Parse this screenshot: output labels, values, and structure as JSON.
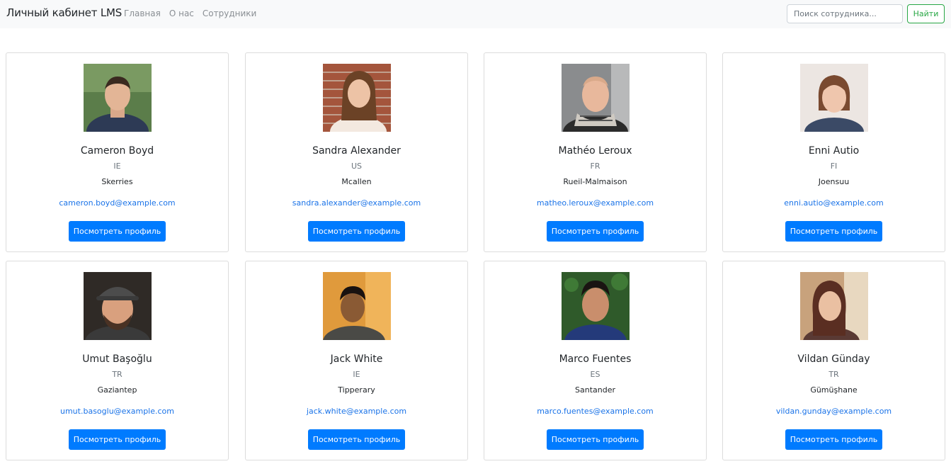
{
  "navbar": {
    "brand": "Личный кабинет LMS",
    "links": [
      "Главная",
      "О нас",
      "Сотрудники"
    ],
    "search_placeholder": "Поиск сотрудника...",
    "search_button": "Найти"
  },
  "colors": {
    "primary": "#007bff",
    "success": "#28a745",
    "link": "#1a73e8",
    "navbar_bg": "#f8f9fa"
  },
  "employees": [
    {
      "name": "Cameron Boyd",
      "country": "IE",
      "city": "Skerries",
      "email": "cameron.boyd@example.com",
      "button": "Посмотреть профиль",
      "photo": "photo-portrait-man"
    },
    {
      "name": "Sandra Alexander",
      "country": "US",
      "city": "Mcallen",
      "email": "sandra.alexander@example.com",
      "button": "Посмотреть профиль",
      "photo": "photo-portrait-woman"
    },
    {
      "name": "Mathéo Leroux",
      "country": "FR",
      "city": "Rueil-Malmaison",
      "email": "matheo.leroux@example.com",
      "button": "Посмотреть профиль",
      "photo": "photo-portrait-man"
    },
    {
      "name": "Enni Autio",
      "country": "FI",
      "city": "Joensuu",
      "email": "enni.autio@example.com",
      "button": "Посмотреть профиль",
      "photo": "photo-portrait-woman"
    },
    {
      "name": "Umut Başoğlu",
      "country": "TR",
      "city": "Gaziantep",
      "email": "umut.basoglu@example.com",
      "button": "Посмотреть профиль",
      "photo": "photo-portrait-man"
    },
    {
      "name": "Jack White",
      "country": "IE",
      "city": "Tipperary",
      "email": "jack.white@example.com",
      "button": "Посмотреть профиль",
      "photo": "photo-portrait-man"
    },
    {
      "name": "Marco Fuentes",
      "country": "ES",
      "city": "Santander",
      "email": "marco.fuentes@example.com",
      "button": "Посмотреть профиль",
      "photo": "photo-portrait-man"
    },
    {
      "name": "Vildan Günday",
      "country": "TR",
      "city": "Gümüşhane",
      "email": "vildan.gunday@example.com",
      "button": "Посмотреть профиль",
      "photo": "photo-portrait-woman"
    }
  ]
}
